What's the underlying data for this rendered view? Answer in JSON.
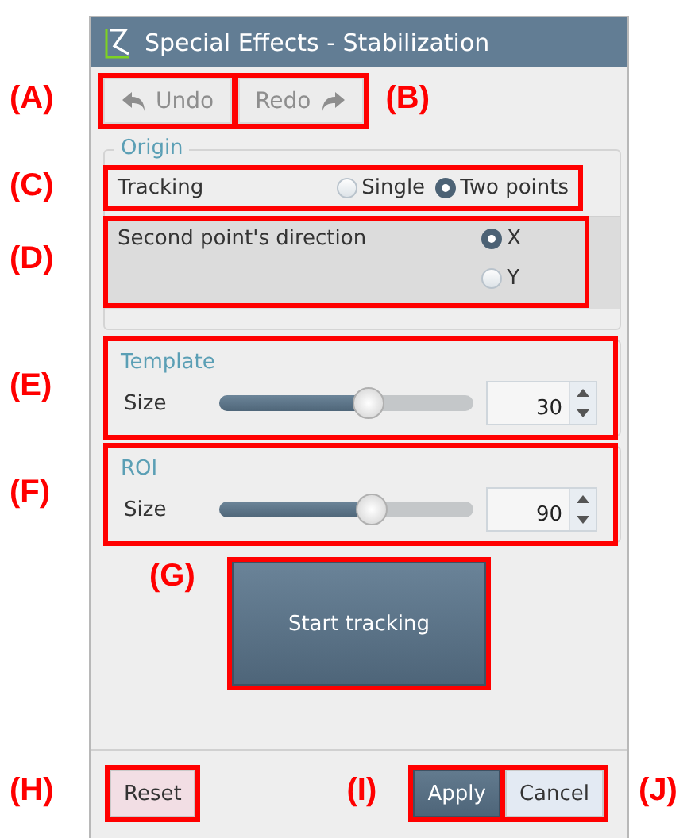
{
  "window": {
    "title": "Special Effects - Stabilization"
  },
  "toolbar": {
    "undo": {
      "label": "Undo",
      "disabled": true,
      "annotation": "(A)"
    },
    "redo": {
      "label": "Redo",
      "disabled": true,
      "annotation": "(B)"
    }
  },
  "origin": {
    "title": "Origin",
    "tracking": {
      "label": "Tracking",
      "annotation": "(C)",
      "options": [
        {
          "label": "Single",
          "selected": false
        },
        {
          "label": "Two points",
          "selected": true
        }
      ]
    },
    "direction": {
      "label": "Second point's direction",
      "annotation": "(D)",
      "options": [
        {
          "label": "X",
          "selected": true
        },
        {
          "label": "Y",
          "selected": false
        }
      ]
    }
  },
  "template": {
    "title": "Template",
    "label": "Size",
    "level": 0.59,
    "value": "30",
    "annotation": "(E)"
  },
  "roi": {
    "title": "ROI",
    "label": "Size",
    "level": 0.6,
    "value": "90",
    "annotation": "(F)"
  },
  "start_button": {
    "label": "Start tracking",
    "annotation": "(G)"
  },
  "footer": {
    "reset": {
      "label": "Reset",
      "annotation": "(H)"
    },
    "apply": {
      "label": "Apply",
      "annotation": "(I)"
    },
    "cancel": {
      "label": "Cancel",
      "annotation": "(J)"
    }
  }
}
